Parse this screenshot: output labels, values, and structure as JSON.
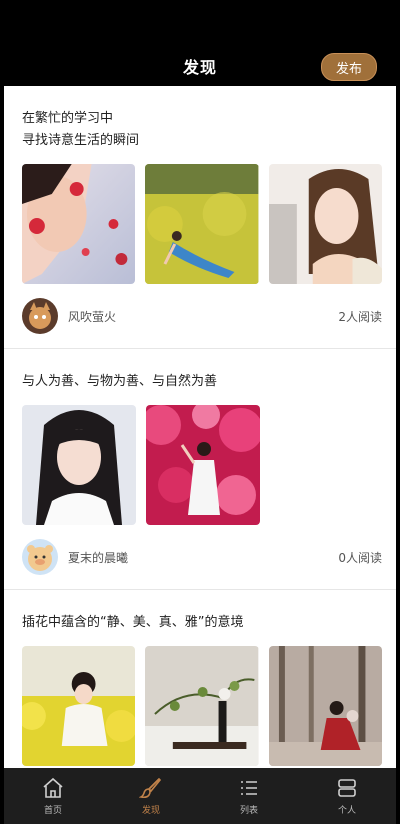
{
  "header": {
    "title": "发现",
    "publish_label": "发布"
  },
  "posts": [
    {
      "text": "在繁忙的学习中\n寻找诗意生活的瞬间",
      "user": "风吹萤火",
      "reads": "2人阅读"
    },
    {
      "text": "与人为善、与物为善、与自然为善",
      "user": "夏末的晨曦",
      "reads": "0人阅读"
    },
    {
      "text": "插花中蕴含的“静、美、真、雅”的意境"
    }
  ],
  "tabs": [
    {
      "label": "首页",
      "icon": "home-icon"
    },
    {
      "label": "发现",
      "icon": "brush-icon"
    },
    {
      "label": "列表",
      "icon": "list-icon"
    },
    {
      "label": "个人",
      "icon": "profile-icon"
    }
  ],
  "colors": {
    "accent": "#c0824a",
    "publish_bg": "#a0703a",
    "tabbar_bg": "#1e1e1e"
  }
}
